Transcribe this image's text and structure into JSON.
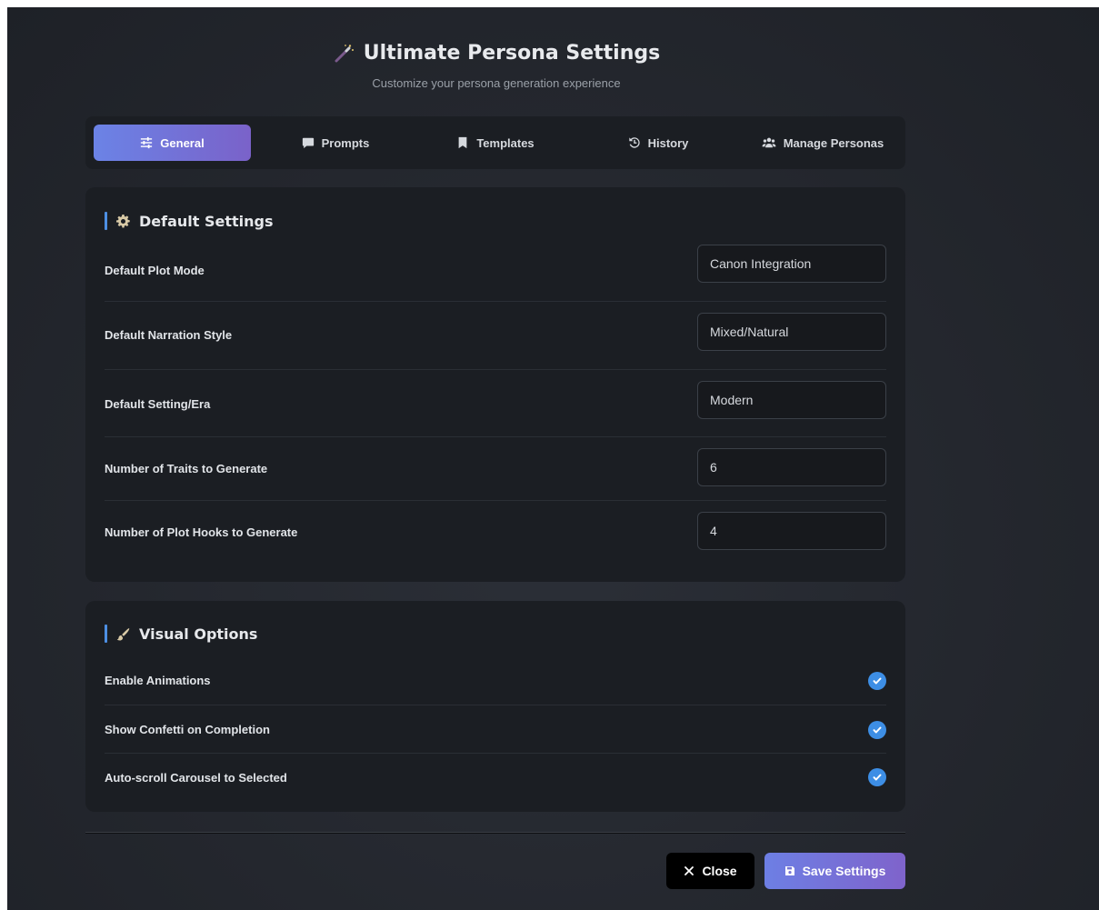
{
  "header": {
    "title": "Ultimate Persona Settings",
    "subtitle": "Customize your persona generation experience",
    "icon": "magic-wand-icon"
  },
  "tabs": [
    {
      "label": "General",
      "icon": "sliders-icon",
      "active": true
    },
    {
      "label": "Prompts",
      "icon": "comment-icon",
      "active": false
    },
    {
      "label": "Templates",
      "icon": "bookmark-icon",
      "active": false
    },
    {
      "label": "History",
      "icon": "history-icon",
      "active": false
    },
    {
      "label": "Manage Personas",
      "icon": "users-icon",
      "active": false
    }
  ],
  "default_settings": {
    "title": "Default Settings",
    "icon": "gear-icon",
    "rows": [
      {
        "label": "Default Plot Mode",
        "value": "Canon Integration"
      },
      {
        "label": "Default Narration Style",
        "value": "Mixed/Natural"
      },
      {
        "label": "Default Setting/Era",
        "value": "Modern"
      },
      {
        "label": "Number of Traits to Generate",
        "value": "6"
      },
      {
        "label": "Number of Plot Hooks to Generate",
        "value": "4"
      }
    ]
  },
  "visual_options": {
    "title": "Visual Options",
    "icon": "paintbrush-icon",
    "options": [
      {
        "label": "Enable Animations",
        "checked": true
      },
      {
        "label": "Show Confetti on Completion",
        "checked": true
      },
      {
        "label": "Auto-scroll Carousel to Selected",
        "checked": true
      }
    ]
  },
  "footer": {
    "close_label": "Close",
    "save_label": "Save Settings"
  },
  "colors": {
    "accent_start": "#6b83e6",
    "accent_end": "#7a62c9",
    "section_bar": "#4d8fe3",
    "checkbox": "#3d8ee5",
    "background": "#24272e"
  }
}
